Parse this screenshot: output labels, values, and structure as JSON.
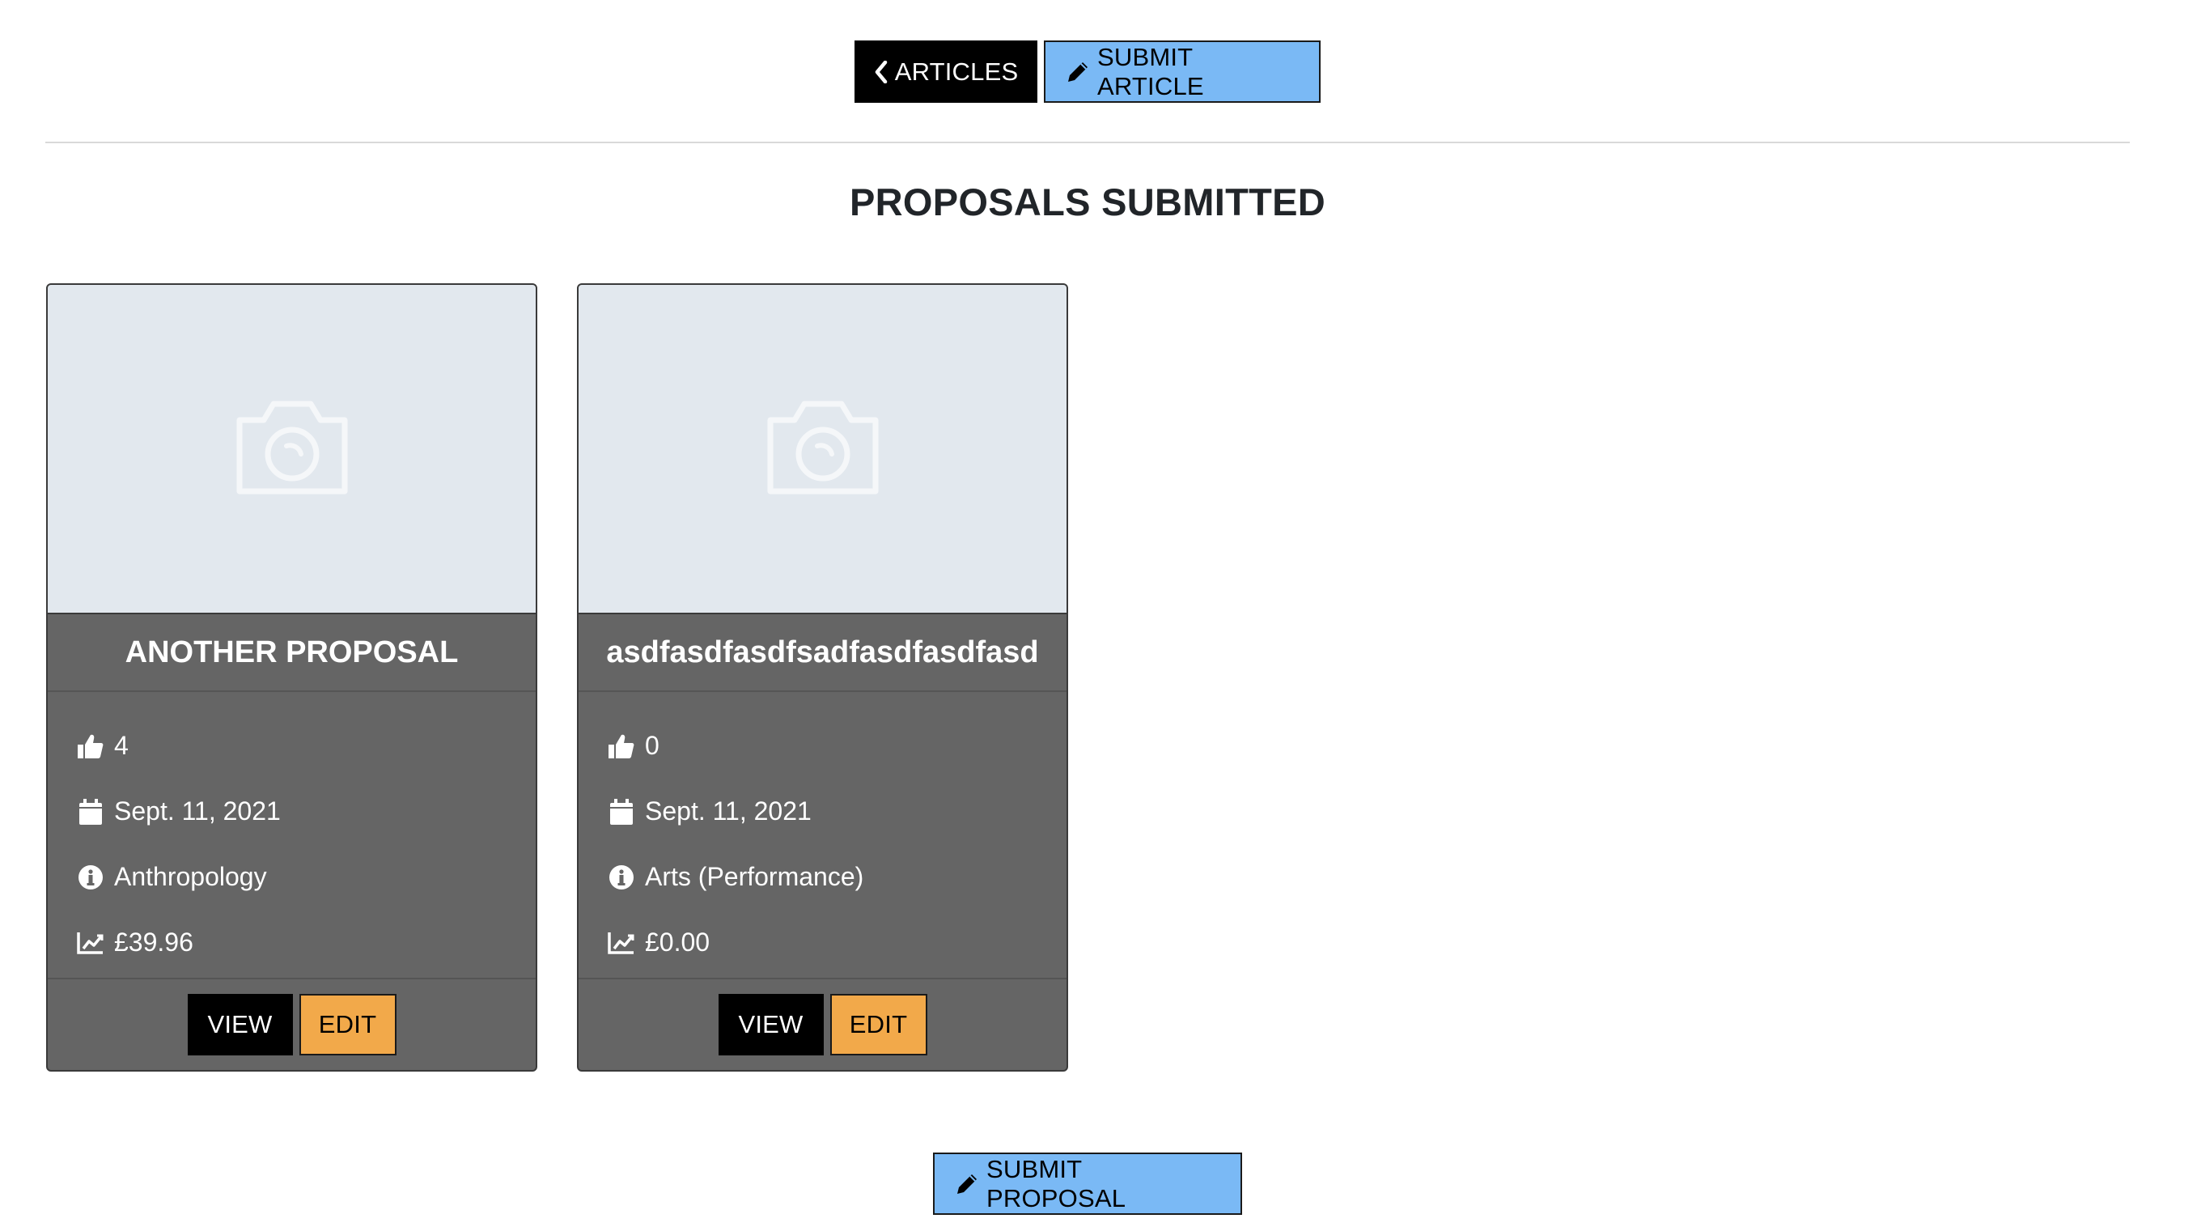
{
  "nav": {
    "articles_label": "ARTICLES",
    "submit_article_label": "SUBMIT ARTICLE"
  },
  "heading": "PROPOSALS SUBMITTED",
  "proposals": [
    {
      "title": "ANOTHER PROPOSAL",
      "likes": "4",
      "date": "Sept. 11, 2021",
      "category": "Anthropology",
      "price": "£39.96",
      "view_label": "VIEW",
      "edit_label": "EDIT"
    },
    {
      "title": "asdfasdfasdfsadfasdfasdfasd",
      "likes": "0",
      "date": "Sept. 11, 2021",
      "category": "Arts (Performance)",
      "price": "£0.00",
      "view_label": "VIEW",
      "edit_label": "EDIT"
    }
  ],
  "submit_proposal_label": "SUBMIT PROPOSAL",
  "colors": {
    "black_button": "#000000",
    "blue_button": "#7ab9f5",
    "orange_button": "#f2a94a",
    "card_background": "#656565",
    "image_placeholder": "#e2e8ee"
  },
  "icons": {
    "back": "chevron-left-icon",
    "pencil": "pencil-icon",
    "placeholder": "camera-icon",
    "likes": "thumbs-up-icon",
    "date": "calendar-icon",
    "category": "info-circle-icon",
    "price": "chart-line-icon"
  }
}
